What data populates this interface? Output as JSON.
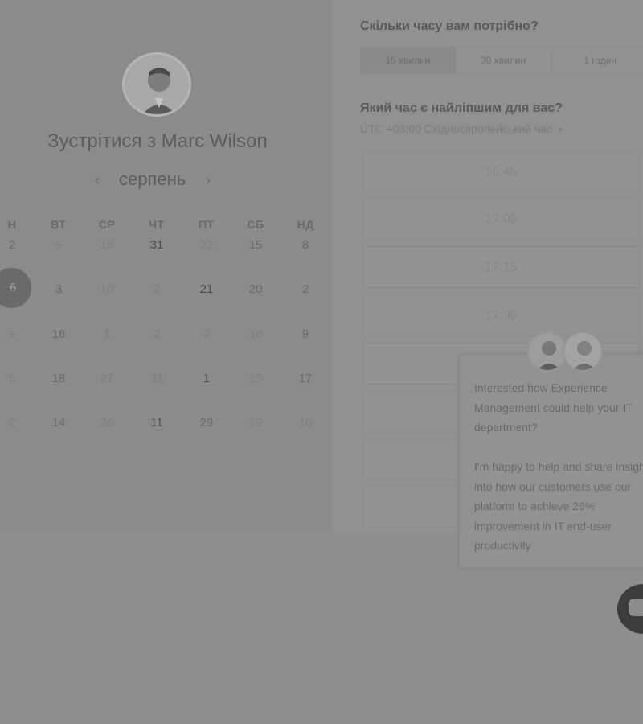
{
  "host": {
    "avatar_icon": "person-avatar-icon",
    "meet_title": "Зустрітися з Marc Wilson"
  },
  "calendar": {
    "prev_icon": "chevron-left-icon",
    "month_label": "серпень",
    "next_icon": "chevron-right-icon",
    "weekdays": [
      "Н",
      "ВТ",
      "СР",
      "ЧТ",
      "ПТ",
      "СБ",
      "НД"
    ],
    "weeks": [
      [
        "2",
        "5",
        "18",
        "31",
        "22",
        "15",
        "8"
      ],
      [
        "6",
        "3",
        "10",
        "2",
        "21",
        "20",
        "2"
      ],
      [
        "≡",
        "16",
        "1",
        "2",
        "2",
        "16",
        "9"
      ],
      [
        "5",
        "18",
        "27",
        "31",
        "1",
        "15",
        "17"
      ],
      [
        "2",
        "14",
        "26",
        "11",
        "29",
        "19",
        "10"
      ]
    ],
    "selected_day": "6"
  },
  "booking": {
    "duration_question": "Скільки часу вам потрібно?",
    "durations": [
      "15 хвилин",
      "30 хвилин",
      "1 годин"
    ],
    "active_duration": "15 хвилин",
    "time_question": "Який час є найліпшим для вас?",
    "timezone": "UTC +03:00 Східноєвропейський час",
    "timezone_caret": "▼",
    "slots": [
      "16:45",
      "17:00",
      "17:15",
      "17:30",
      "",
      "",
      ""
    ]
  },
  "chat": {
    "message": "Interested how Experience Management could help your IT department?\n\nI'm happy to help and share insight into how our customers use our platform to achieve 26% improvement in IT end-user productivity",
    "avatar_icons": [
      "agent-avatar-icon",
      "agent-avatar-icon"
    ],
    "launcher_icon": "chat-bubble-icon"
  }
}
